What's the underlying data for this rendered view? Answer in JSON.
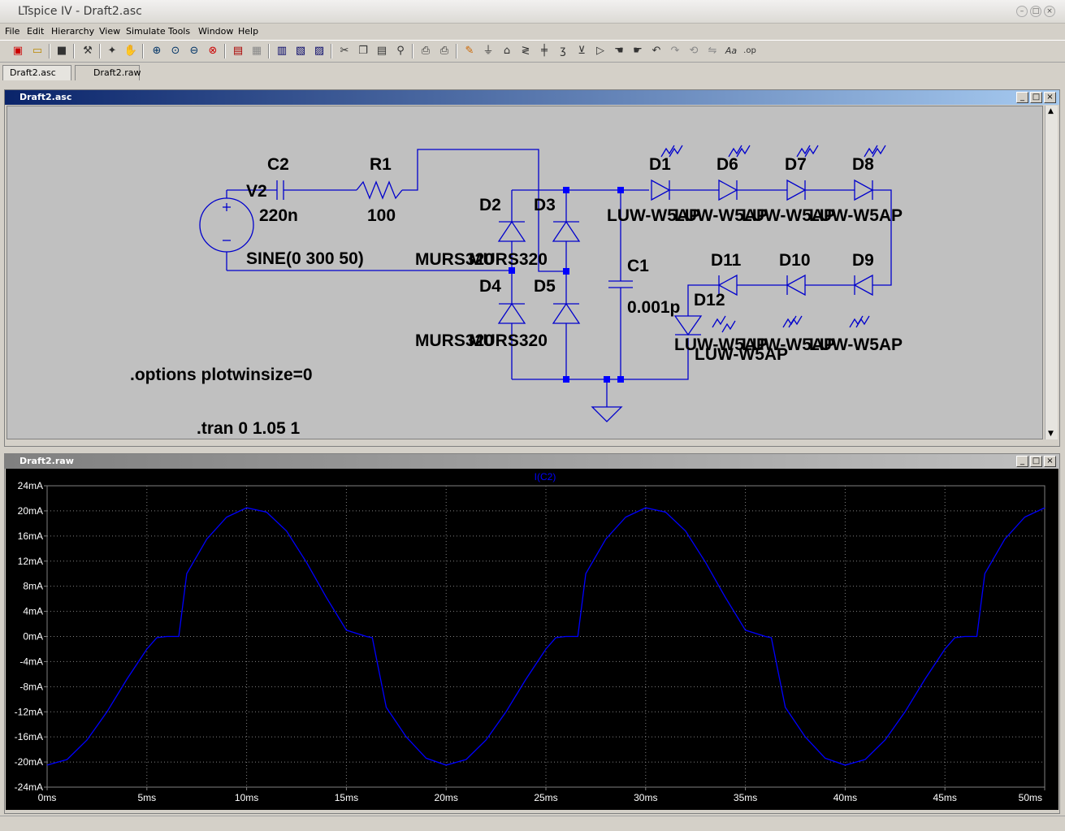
{
  "window": {
    "title": "LTspice IV - Draft2.asc"
  },
  "menu": [
    "File",
    "Edit",
    "Hierarchy",
    "View",
    "Simulate",
    "Tools",
    "Window",
    "Help"
  ],
  "tabs": [
    {
      "label": "Draft2.asc"
    },
    {
      "label": "Draft2.raw"
    }
  ],
  "schematic": {
    "title": "Draft2.asc",
    "labels": {
      "c2": "C2",
      "c2_val": "220n",
      "r1": "R1",
      "r1_val": "100",
      "v2": "V2",
      "v2_val": "SINE(0 300 50)",
      "d2": "D2",
      "d3": "D3",
      "d4": "D4",
      "d5": "D5",
      "mur_top": "MURS320",
      "mur_top2": "MURS320",
      "mur_bot": "MURS320",
      "mur_bot2": "MURS320",
      "c1": "C1",
      "c1_val": "0.001p",
      "d1": "D1",
      "d6": "D6",
      "d7": "D7",
      "d8": "D8",
      "luw_1": "LUW-W5AP",
      "luw_6": "LUW-W5AP",
      "luw_7": "LUW-W5AP",
      "luw_8": "LUW-W5AP",
      "d11": "D11",
      "d10": "D10",
      "d9": "D9",
      "d12": "D12",
      "luw_11": "LUW-W5AP",
      "luw_10": "LUW-W5AP",
      "luw_9": "LUW-W5AP",
      "luw_12": "LUW-W5AP",
      "directive_options": ".options plotwinsize=0",
      "directive_tran": ".tran 0 1.05 1"
    }
  },
  "plot": {
    "title": "Draft2.raw",
    "trace_label": "I(C2)",
    "colors": {
      "trace": "#0000ff",
      "grid": "#808080",
      "axis_text": "#ffffff"
    }
  },
  "chart_data": {
    "type": "line",
    "title": "",
    "xlabel": "",
    "ylabel": "",
    "x_unit": "ms",
    "y_unit": "mA",
    "xlim": [
      0,
      50
    ],
    "ylim": [
      -24,
      24
    ],
    "x_ticks": [
      "0ms",
      "5ms",
      "10ms",
      "15ms",
      "20ms",
      "25ms",
      "30ms",
      "35ms",
      "40ms",
      "45ms",
      "50ms"
    ],
    "y_ticks": [
      "24mA",
      "20mA",
      "16mA",
      "12mA",
      "8mA",
      "4mA",
      "0mA",
      "-4mA",
      "-8mA",
      "-12mA",
      "-16mA",
      "-20mA",
      "-24mA"
    ],
    "grid": true,
    "series": [
      {
        "name": "I(C2)",
        "x": [
          0,
          1,
          2,
          3,
          4,
          5,
          5.5,
          6,
          6.3,
          6.6,
          7,
          8,
          9,
          10,
          11,
          12,
          13,
          14,
          15,
          16,
          16.3,
          16.6,
          17,
          18,
          19,
          20,
          21,
          22,
          23,
          24,
          25,
          25.5,
          26,
          26.3,
          26.6,
          27,
          28,
          29,
          30,
          31,
          32,
          33,
          34,
          35,
          36,
          36.3,
          36.6,
          37,
          38,
          39,
          40,
          41,
          42,
          43,
          44,
          45,
          45.5,
          46,
          46.3,
          46.6,
          47,
          48,
          49,
          50
        ],
        "y": [
          -20.5,
          -19.6,
          -16.5,
          -12,
          -6.8,
          -2,
          -0.2,
          0,
          0,
          0,
          10,
          15.5,
          19,
          20.5,
          19.8,
          16.8,
          11.8,
          6.2,
          1,
          0,
          -0.2,
          -5,
          -11.3,
          -16,
          -19.4,
          -20.5,
          -19.6,
          -16.5,
          -12,
          -6.8,
          -2,
          -0.2,
          0,
          0,
          0,
          10,
          15.5,
          19,
          20.5,
          19.8,
          16.8,
          11.8,
          6.2,
          1,
          0,
          -0.2,
          -5,
          -11.3,
          -16,
          -19.4,
          -20.5,
          -19.6,
          -16.5,
          -12,
          -6.8,
          -2,
          -0.2,
          0,
          0,
          0,
          10,
          15.5,
          19,
          20.5
        ]
      }
    ]
  }
}
